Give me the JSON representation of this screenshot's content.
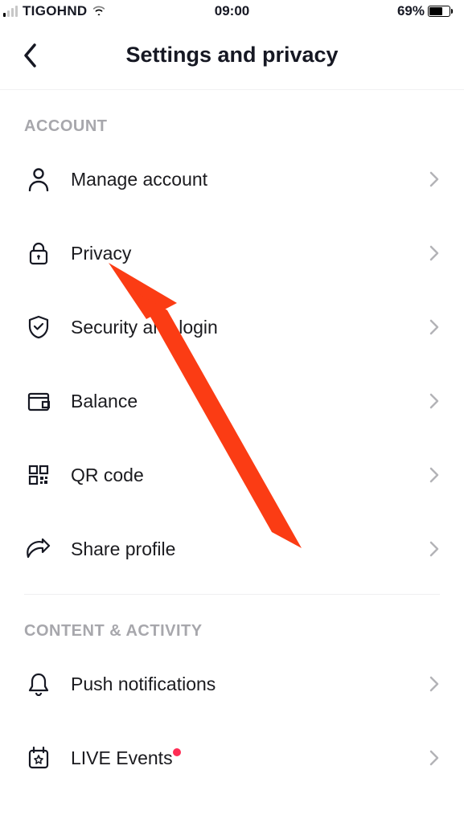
{
  "status": {
    "carrier": "TIGOHND",
    "time": "09:00",
    "battery_percent": "69%"
  },
  "header": {
    "title": "Settings and privacy"
  },
  "sections": [
    {
      "title": "ACCOUNT",
      "items": [
        {
          "label": "Manage account"
        },
        {
          "label": "Privacy"
        },
        {
          "label": "Security and login"
        },
        {
          "label": "Balance"
        },
        {
          "label": "QR code"
        },
        {
          "label": "Share profile"
        }
      ]
    },
    {
      "title": "CONTENT & ACTIVITY",
      "items": [
        {
          "label": "Push notifications"
        },
        {
          "label": "LIVE Events",
          "badge": true
        }
      ]
    }
  ],
  "annotation": {
    "color": "#fb3c14"
  }
}
